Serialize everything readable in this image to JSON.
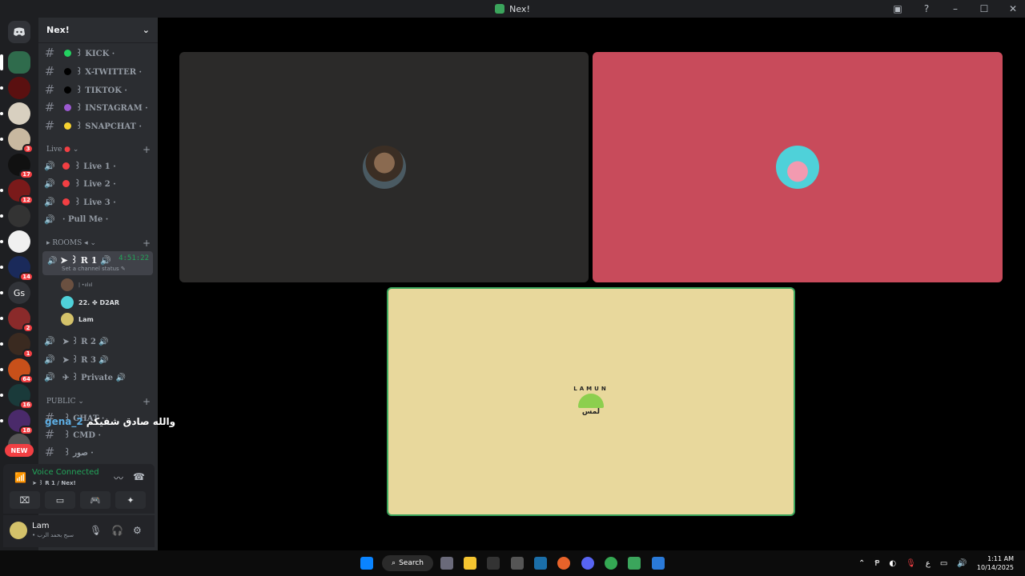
{
  "window": {
    "title": "Nex!"
  },
  "server": {
    "name": "Nex!"
  },
  "social_channels": [
    {
      "label": "꒱ KICK ·",
      "dot": "#23d160"
    },
    {
      "label": "꒱ X-TWITTER ·",
      "dot": "#000000"
    },
    {
      "label": "꒱ TIKTOK ·",
      "dot": "#000000"
    },
    {
      "label": "꒱ INSTAGRAM ·",
      "dot": "#9b59d0"
    },
    {
      "label": "꒱ SNAPCHAT ·",
      "dot": "#f5d130"
    }
  ],
  "live_category": {
    "label": "Live"
  },
  "live_channels": [
    {
      "label": "꒱ Live 1 ·"
    },
    {
      "label": "꒱ Live 2 ·"
    },
    {
      "label": "꒱ Live 3 ·"
    },
    {
      "label": "· Pull Me ·"
    }
  ],
  "rooms_category": {
    "label": "▸ ROOMS ◂"
  },
  "active_room": {
    "label": "➤ ꒱ R 1 🔊",
    "elapsed": "4:51:22",
    "status": "Set a channel status ✎"
  },
  "voice_users": [
    {
      "name": "| •ıılııl",
      "color": "#6a5040"
    },
    {
      "name": "22.  ✤ D2AR",
      "color": "#f29ab0"
    },
    {
      "name": "Lam",
      "color": "#d4c26a"
    }
  ],
  "room_channels": [
    {
      "label": "➤ ꒱ R 2 🔊"
    },
    {
      "label": "➤ ꒱ R 3 🔊"
    },
    {
      "label": "✈ ꒱ Private 🔊"
    }
  ],
  "public_category": {
    "label": "PUBLIC"
  },
  "public_channels": [
    {
      "label": "꒱ CHAT ·"
    },
    {
      "label": "꒱ CMD ·"
    },
    {
      "label": "꒱ صور ·"
    }
  ],
  "overlay_message": {
    "user": "gena_2",
    "text": "والله صادق شفيكم"
  },
  "guild_badges": [
    "3",
    "17",
    "12",
    "14",
    "2",
    "1",
    "64",
    "16",
    "18"
  ],
  "guild_text": "Gs",
  "guild_new": "NEW",
  "voice_status": {
    "title": "Voice Connected",
    "subtitle": "➤ ꒱ R 1 / Nex!"
  },
  "user": {
    "name": "Lam",
    "status": "• سبح بحمد الرب"
  },
  "taskbar": {
    "search": "Search"
  },
  "clock": {
    "time": "1:11 AM",
    "date": "10/14/2025"
  },
  "tray_lang": "ع"
}
